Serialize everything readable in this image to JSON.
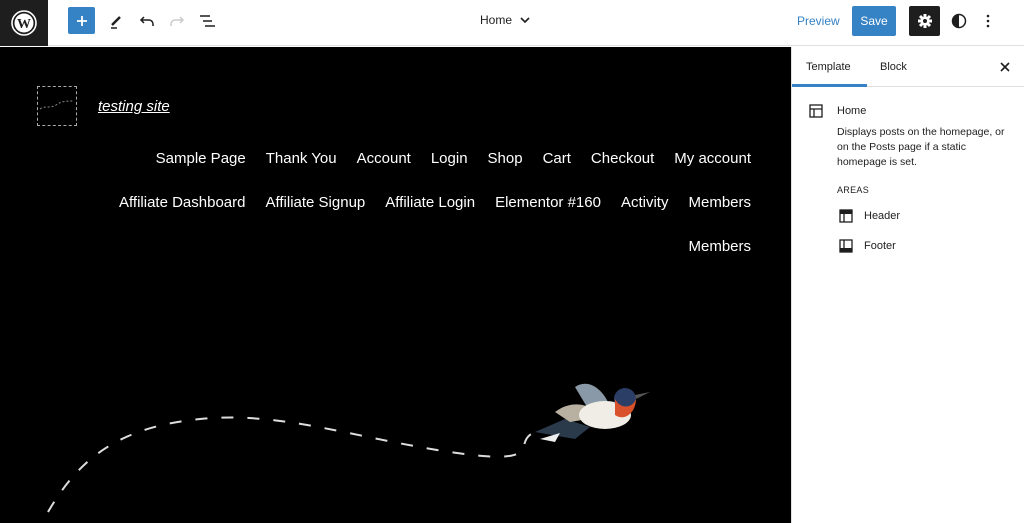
{
  "toolbar": {
    "logo_icon": "wordpress-logo-icon",
    "add_icon": "plus-icon",
    "tools": [
      "pencil-icon",
      "undo-icon",
      "redo-icon",
      "list-view-icon"
    ],
    "document_title": "Home",
    "preview_label": "Preview",
    "save_label": "Save",
    "settings_icon": "gear-icon",
    "styles_icon": "half-circle-icon",
    "options_icon": "vertical-ellipsis-icon"
  },
  "colors": {
    "accent": "#3582c4",
    "dark": "#1e1e1e",
    "canvas": "#000000"
  },
  "canvas": {
    "site_title": "testing site",
    "nav_rows": [
      [
        "Sample Page",
        "Thank You",
        "Account",
        "Login",
        "Shop",
        "Cart",
        "Checkout",
        "My account"
      ],
      [
        "Affiliate Dashboard",
        "Affiliate Signup",
        "Affiliate Login",
        "Elementor #160",
        "Activity",
        "Members"
      ],
      [
        "Members"
      ]
    ]
  },
  "sidebar": {
    "tabs": [
      "Template",
      "Block"
    ],
    "active_tab": "Template",
    "template_name": "Home",
    "template_description": "Displays posts on the homepage, or on the Posts page if a static homepage is set.",
    "areas_label": "AREAS",
    "areas": [
      "Header",
      "Footer"
    ]
  }
}
